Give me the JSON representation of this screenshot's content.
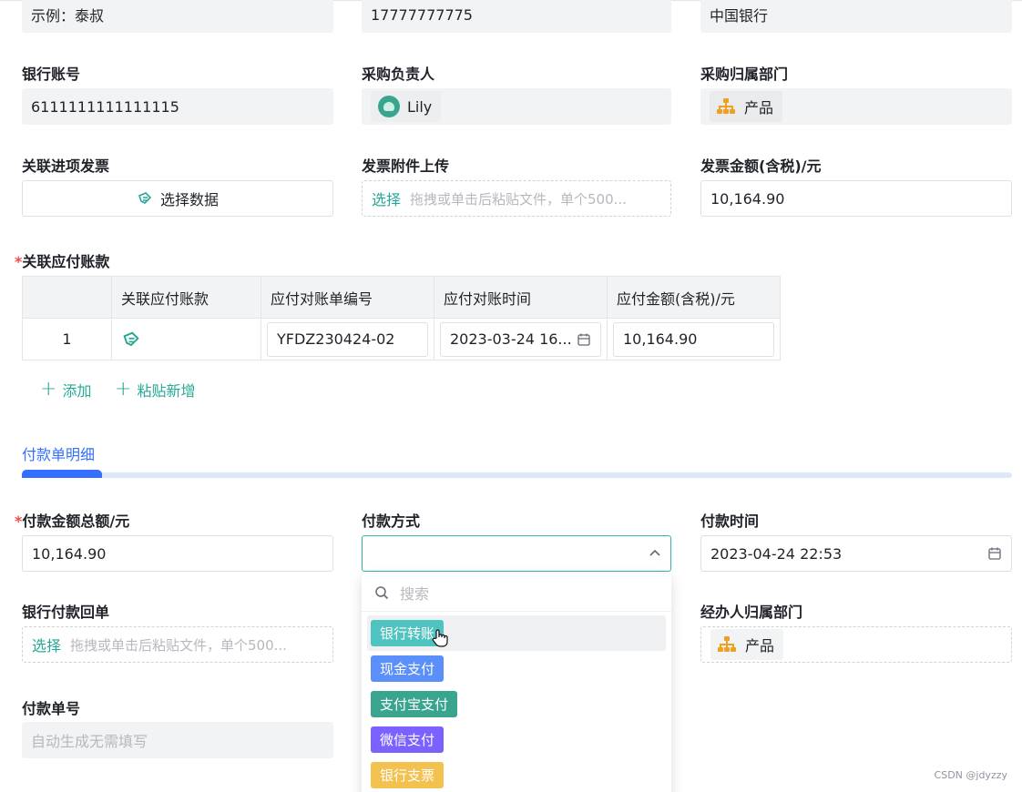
{
  "top_row": {
    "supplier_contact_value": "示例：泰叔",
    "phone_value": "17777777775",
    "bank_value": "中国银行"
  },
  "row2": {
    "bank_account_label": "银行账号",
    "bank_account_value": "6111111111111115",
    "purchaser_label": "采购负责人",
    "purchaser_value": "Lily",
    "purchase_dept_label": "采购归属部门",
    "purchase_dept_value": "产品"
  },
  "row3": {
    "invoice_link_label": "关联进项发票",
    "select_data_label": "选择数据",
    "invoice_attach_label": "发票附件上传",
    "upload_select": "选择",
    "upload_hint": "拖拽或单击后粘贴文件，单个500...",
    "invoice_amount_label": "发票金额(含税)/元",
    "invoice_amount_value": "10,164.90"
  },
  "payables": {
    "required_mark": "*",
    "label": "关联应付账款",
    "columns": [
      "",
      "关联应付账款",
      "应付对账单编号",
      "应付对账时间",
      "应付金额(含税)/元"
    ],
    "rows": [
      {
        "index": "1",
        "statement_no": "YFDZ230424-02",
        "statement_time": "2023-03-24 16...",
        "amount": "10,164.90"
      }
    ],
    "add_label": "添加",
    "paste_add_label": "粘贴新增"
  },
  "detail_tab": {
    "title": "付款单明细"
  },
  "payment": {
    "required_mark": "*",
    "total_label": "付款金额总额/元",
    "total_value": "10,164.90",
    "method_label": "付款方式",
    "method_value": "",
    "time_label": "付款时间",
    "time_value": "2023-04-24 22:53",
    "receipt_label": "银行付款回单",
    "receipt_select": "选择",
    "receipt_hint": "拖拽或单击后粘贴文件，单个500...",
    "handler_dept_label": "经办人归属部门",
    "handler_dept_value": "产品",
    "payment_no_label": "付款单号",
    "payment_no_placeholder": "自动生成无需填写"
  },
  "dropdown": {
    "search_placeholder": "搜索",
    "options": [
      {
        "label": "银行转账",
        "color": "#4fc3c0"
      },
      {
        "label": "现金支付",
        "color": "#5b8ff9"
      },
      {
        "label": "支付宝支付",
        "color": "#3aa58e"
      },
      {
        "label": "微信支付",
        "color": "#7b61ff"
      },
      {
        "label": "银行支票",
        "color": "#f2c14e"
      }
    ]
  },
  "watermark": "CSDN @jdyzzy"
}
